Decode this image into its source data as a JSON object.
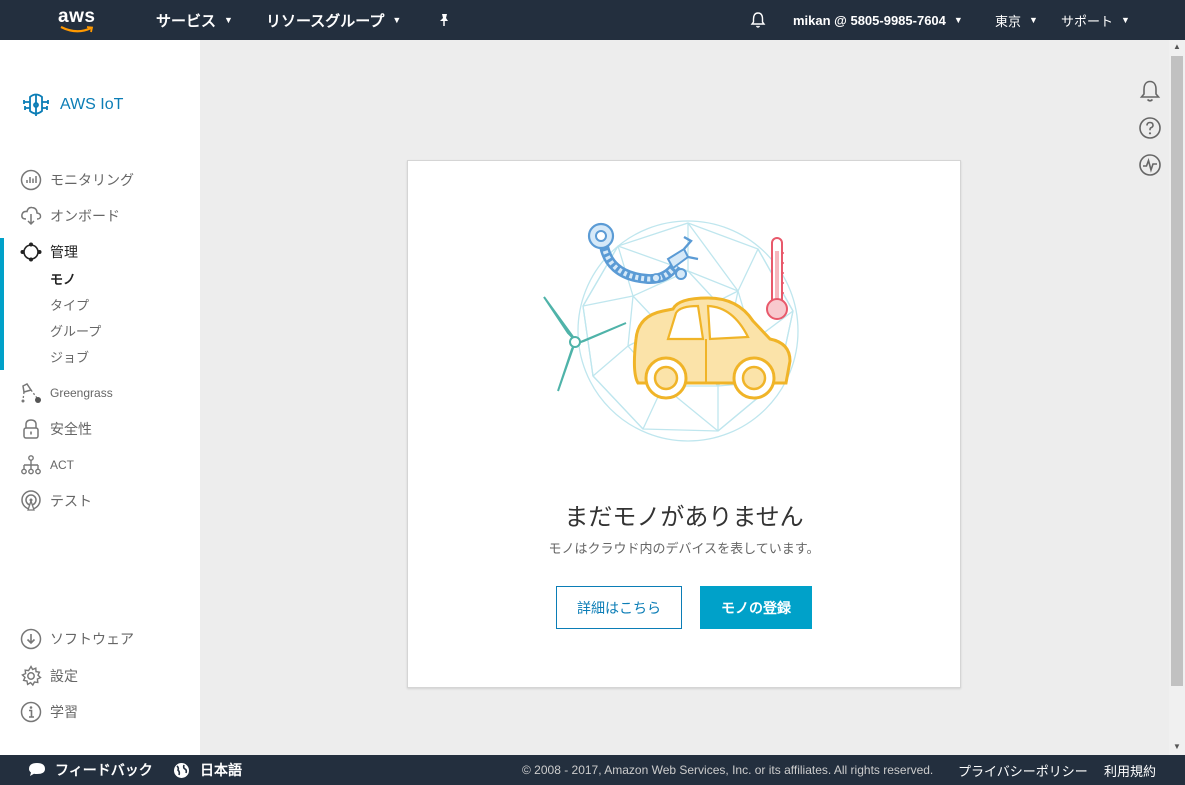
{
  "topbar": {
    "logo": "aws",
    "services": "サービス",
    "resource_groups": "リソースグループ",
    "account": "mikan @ 5805-9985-7604",
    "region": "東京",
    "support": "サポート",
    "icons": [
      "pin-icon",
      "bell-icon"
    ]
  },
  "sidebar": {
    "brand": "AWS IoT",
    "items": [
      {
        "label": "モニタリング",
        "icon": "monitor-icon"
      },
      {
        "label": "オンボード",
        "icon": "onboard-icon"
      },
      {
        "label": "管理",
        "icon": "manage-icon"
      },
      {
        "label": "Greengrass",
        "icon": "greengrass-icon"
      },
      {
        "label": "安全性",
        "icon": "lock-icon"
      },
      {
        "label": "ACT",
        "icon": "act-icon"
      },
      {
        "label": "テスト",
        "icon": "test-icon"
      }
    ],
    "sub_items": [
      "モノ",
      "タイプ",
      "グループ",
      "ジョブ"
    ],
    "bottom_items": [
      {
        "label": "ソフトウェア",
        "icon": "download-icon"
      },
      {
        "label": "設定",
        "icon": "gear-icon"
      },
      {
        "label": "学習",
        "icon": "info-icon"
      }
    ]
  },
  "right_icons": [
    "bell-icon",
    "help-icon",
    "activity-icon"
  ],
  "main": {
    "title": "まだモノがありません",
    "description": "モノはクラウド内のデバイスを表しています。",
    "learn_more": "詳細はこちら",
    "register": "モノの登録"
  },
  "footer": {
    "feedback": "フィードバック",
    "language": "日本語",
    "copyright": "© 2008 - 2017, Amazon Web Services, Inc. or its affiliates. All rights reserved.",
    "privacy": "プライバシーポリシー",
    "terms": "利用規約"
  },
  "colors": {
    "nav_bg": "#232f3e",
    "accent": "#00a1c9",
    "brand": "#0b7db6"
  }
}
